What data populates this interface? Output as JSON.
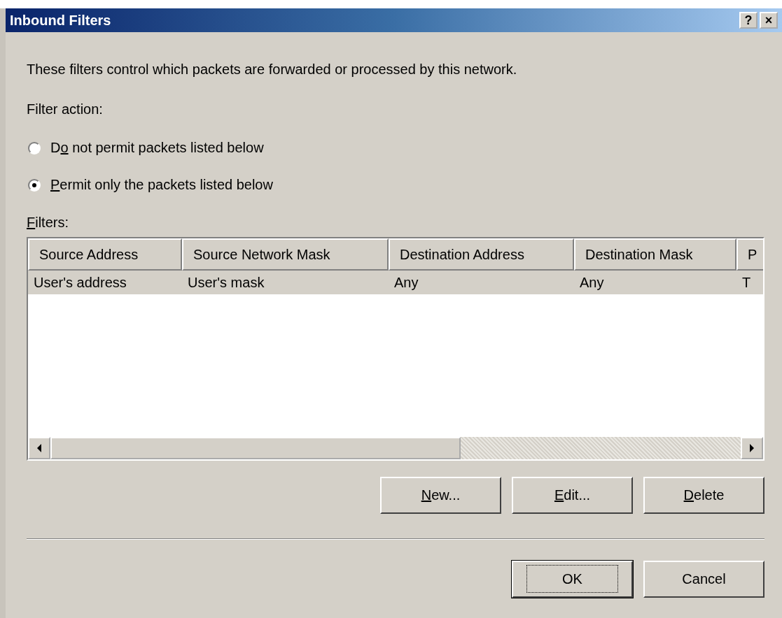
{
  "window": {
    "title": "Inbound Filters",
    "help_button": "?",
    "close_button": "×"
  },
  "description": "These filters control which packets are forwarded or processed by this network.",
  "filter_action": {
    "label": "Filter action:",
    "options": [
      {
        "before": "D",
        "key": "o",
        "after": " not permit packets listed below",
        "selected": false
      },
      {
        "key": "P",
        "after": "ermit only the packets listed below",
        "selected": true
      }
    ]
  },
  "filters": {
    "label": {
      "key": "F",
      "after": "ilters:"
    },
    "columns": [
      "Source Address",
      "Source Network Mask",
      "Destination Address",
      "Destination Mask",
      "P"
    ],
    "rows": [
      {
        "cells": [
          "User's address",
          "User's mask",
          "Any",
          "Any",
          "T"
        ],
        "selected": true
      }
    ]
  },
  "list_buttons": [
    {
      "key": "N",
      "after": "ew..."
    },
    {
      "key": "E",
      "after": "dit..."
    },
    {
      "key": "D",
      "after": "elete"
    }
  ],
  "dialog_buttons": [
    {
      "label": "OK",
      "default": true
    },
    {
      "label": "Cancel",
      "default": false
    }
  ]
}
